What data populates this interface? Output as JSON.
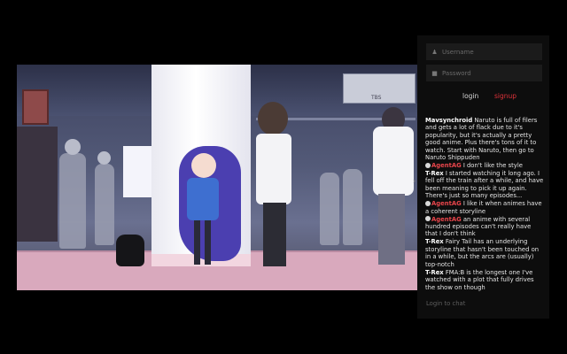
{
  "video": {
    "sign_text": "TBS"
  },
  "panel": {
    "username_placeholder": "Username",
    "password_placeholder": "Password",
    "login_label": "login",
    "signup_label": "signup",
    "login_to_chat": "Login to chat",
    "collapse_glyph": "›"
  },
  "chat": [
    {
      "user": "Mavsynchroid",
      "badge": false,
      "text": " Naruto is full of filers and gets a lot of flack due to it's popularity, but it's actually a pretty good anime. Plus there's tons of it to watch. Start with Naruto, then go to Naruto Shippuden"
    },
    {
      "user": "AgentAG",
      "badge": true,
      "text": " I don't like the style"
    },
    {
      "user": "T-Rex",
      "badge": false,
      "text": " I started watching it long ago. I fell off the train after a while, and have been meaning to pick it up again. There's just so many episodes..."
    },
    {
      "user": "AgentAG",
      "badge": true,
      "text": " I like it when animes have a coherent storyline"
    },
    {
      "user": "AgentAG",
      "badge": true,
      "text": " an anime with several hundred episodes can't really have that I don't think"
    },
    {
      "user": "T-Rex",
      "badge": false,
      "text": " Fairy Tail has an underlying storyline that hasn't been touched on in a while, but the arcs are (usually) top-notch"
    },
    {
      "user": "T-Rex",
      "badge": false,
      "text": " FMA:B is the longest one I've watched with a plot that fully drives the show on though"
    }
  ],
  "colors": {
    "accent_red": "#e0323a",
    "panel_bg": "#0d0d0d"
  }
}
